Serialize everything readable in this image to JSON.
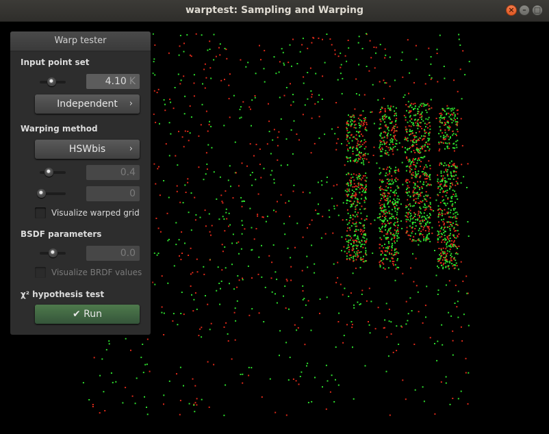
{
  "window": {
    "title": "warptest: Sampling and Warping"
  },
  "panel": {
    "title": "Warp tester",
    "input_point_set": {
      "label": "Input point set",
      "slider_level": 0.45,
      "count_value": "4.10",
      "count_unit": "K",
      "sampler_label": "Independent"
    },
    "warping_method": {
      "label": "Warping method",
      "method_label": "HSWbis",
      "param1_value": "0.4",
      "param2_value": "0",
      "visualize_grid_label": "Visualize warped grid"
    },
    "bsdf": {
      "label": "BSDF parameters",
      "value": "0.0",
      "visualize_brdf_label": "Visualize BRDF values"
    },
    "chi2": {
      "label": "χ² hypothesis test",
      "run_label": "Run"
    }
  },
  "colors": {
    "point_green": "#2ee02e",
    "point_red": "#e02a1a",
    "accent_run": "#4a7a4a"
  }
}
